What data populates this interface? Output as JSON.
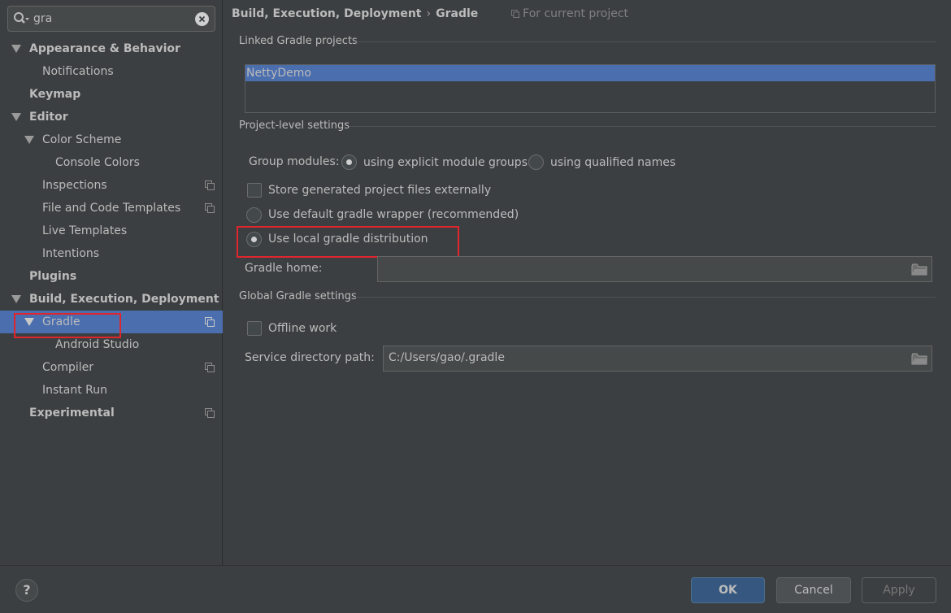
{
  "search": {
    "value": "gra"
  },
  "tree": [
    {
      "label": "Appearance & Behavior",
      "bold": true
    },
    {
      "label": "Notifications"
    },
    {
      "label": "Keymap",
      "bold": true
    },
    {
      "label": "Editor",
      "bold": true
    },
    {
      "label": "Color Scheme"
    },
    {
      "label": "Console Colors"
    },
    {
      "label": "Inspections"
    },
    {
      "label": "File and Code Templates"
    },
    {
      "label": "Live Templates"
    },
    {
      "label": "Intentions"
    },
    {
      "label": "Plugins",
      "bold": true
    },
    {
      "label": "Build, Execution, Deployment",
      "bold": true
    },
    {
      "label": "Gradle",
      "selected": true
    },
    {
      "label": "Android Studio"
    },
    {
      "label": "Compiler"
    },
    {
      "label": "Instant Run"
    },
    {
      "label": "Experimental",
      "bold": true
    }
  ],
  "breadcrumb": {
    "parent": "Build, Execution, Deployment",
    "separator": "›",
    "current": "Gradle",
    "scope": "For current project"
  },
  "linked": {
    "title": "Linked Gradle projects",
    "projects": [
      "NettyDemo"
    ]
  },
  "project_settings": {
    "title": "Project-level settings",
    "group_modules_label": "Group modules:",
    "group_option_1": "using explicit module groups",
    "group_option_2": "using qualified names",
    "store_externally": "Store generated project files externally",
    "use_default_wrapper": "Use default gradle wrapper (recommended)",
    "use_local_distribution": "Use local gradle distribution",
    "gradle_home_label": "Gradle home:",
    "gradle_home_value": ""
  },
  "global_settings": {
    "title": "Global Gradle settings",
    "offline_work": "Offline work",
    "service_dir_label": "Service directory path:",
    "service_dir_value": "C:/Users/gao/.gradle"
  },
  "footer": {
    "help": "?",
    "ok": "OK",
    "cancel": "Cancel",
    "apply": "Apply"
  },
  "colors": {
    "background": "#3c3f41",
    "selection": "#4b6eaf",
    "ok_button": "#365880",
    "highlight_box": "#e0262d"
  }
}
